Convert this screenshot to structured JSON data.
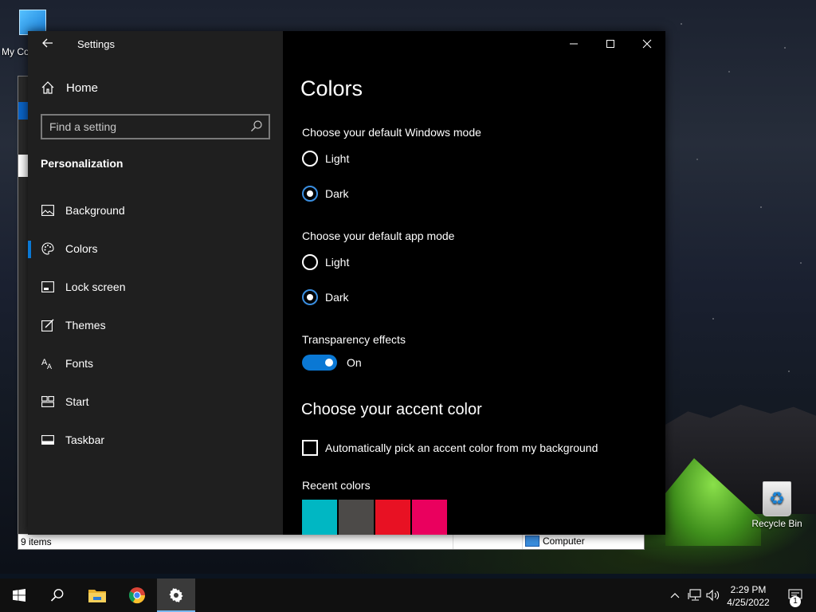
{
  "desktop": {
    "icons": [
      {
        "label": "My Co"
      },
      {
        "label": "Recycle Bin"
      }
    ]
  },
  "explorer": {
    "status_items": "9 items",
    "status_location": "Computer"
  },
  "settings": {
    "title": "Settings",
    "nav": {
      "home_label": "Home",
      "search_placeholder": "Find a setting",
      "section": "Personalization",
      "items": [
        {
          "label": "Background",
          "icon": "picture-icon"
        },
        {
          "label": "Colors",
          "icon": "palette-icon",
          "active": true
        },
        {
          "label": "Lock screen",
          "icon": "lock-screen-icon"
        },
        {
          "label": "Themes",
          "icon": "themes-icon"
        },
        {
          "label": "Fonts",
          "icon": "fonts-icon"
        },
        {
          "label": "Start",
          "icon": "start-icon"
        },
        {
          "label": "Taskbar",
          "icon": "taskbar-icon"
        }
      ]
    },
    "content": {
      "page_title": "Colors",
      "windows_mode": {
        "label": "Choose your default Windows mode",
        "options": [
          "Light",
          "Dark"
        ],
        "selected": "Dark"
      },
      "app_mode": {
        "label": "Choose your default app mode",
        "options": [
          "Light",
          "Dark"
        ],
        "selected": "Dark"
      },
      "transparency": {
        "label": "Transparency effects",
        "state": "On"
      },
      "accent_heading": "Choose your accent color",
      "auto_accent_label": "Automatically pick an accent color from my background",
      "recent_colors_label": "Recent colors",
      "recent_colors": [
        "#00b7c3",
        "#4c4a48",
        "#e81123",
        "#ea005e"
      ]
    },
    "accent_color": "#0a78d4"
  },
  "taskbar": {
    "time": "2:29 PM",
    "date": "4/25/2022",
    "notification_count": "1",
    "pinned": [
      "start-icon",
      "search-icon",
      "file-explorer-icon",
      "chrome-icon",
      "settings-gear-icon"
    ]
  }
}
